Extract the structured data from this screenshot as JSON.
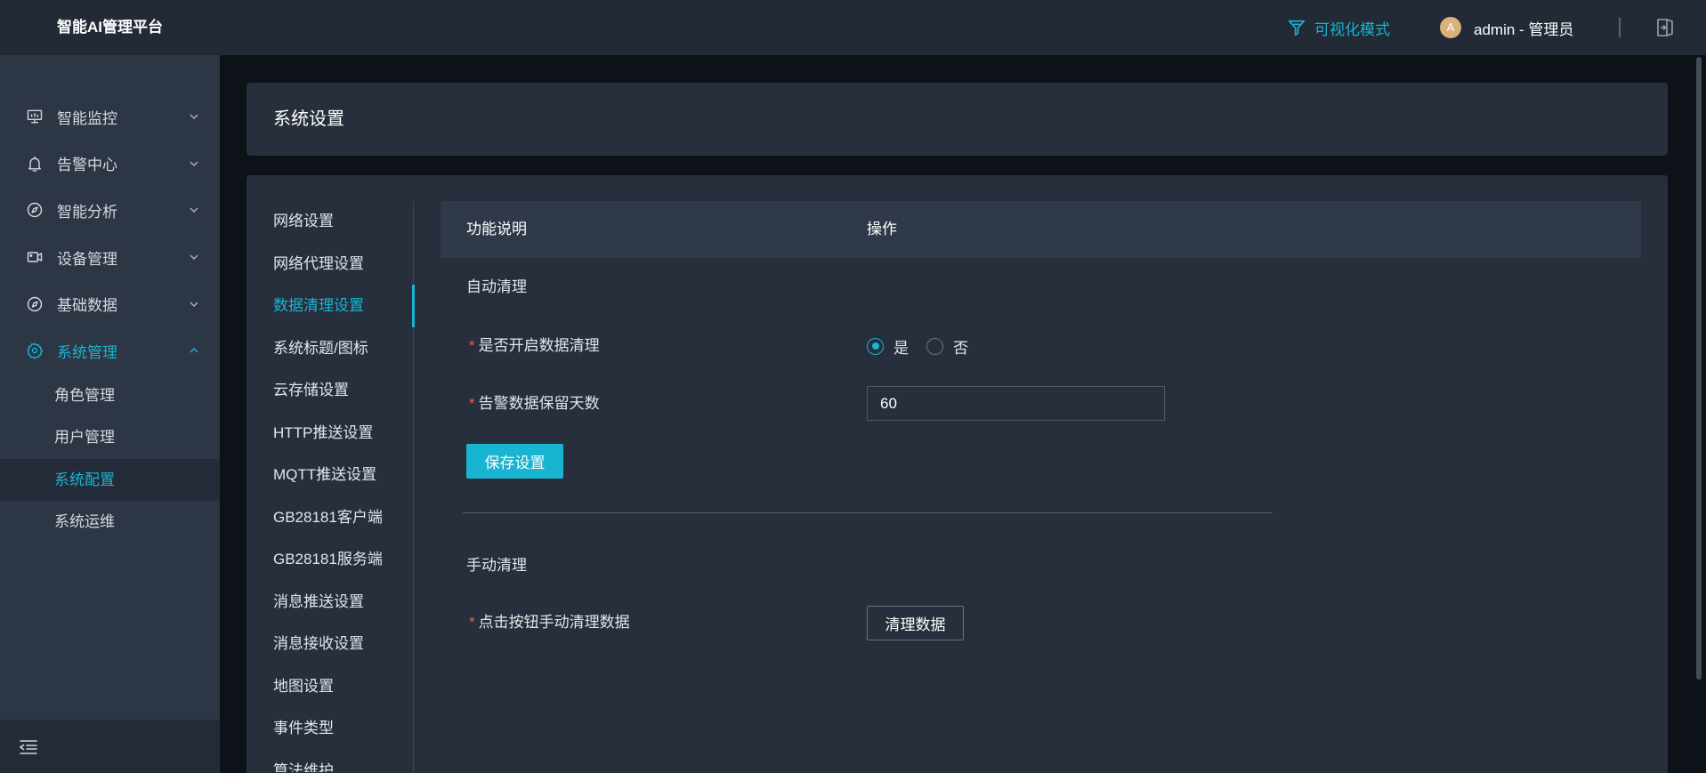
{
  "theme": {
    "accent": "#19b4d1",
    "required": "#f25a5a",
    "avatar": "#d8b27a"
  },
  "header": {
    "logo": "智能AI管理平台",
    "visual_mode": {
      "label": "可视化模式",
      "icon": "visual-mode-icon"
    },
    "user": {
      "avatar_initial": "A",
      "label": "admin - 管理员"
    },
    "logout_icon": "logout-icon"
  },
  "sidebar": {
    "menu": [
      {
        "label": "智能监控",
        "icon": "monitor-icon",
        "expanded": false
      },
      {
        "label": "告警中心",
        "icon": "bell-icon",
        "expanded": false
      },
      {
        "label": "智能分析",
        "icon": "compass-icon",
        "expanded": false
      },
      {
        "label": "设备管理",
        "icon": "video-camera-icon",
        "expanded": false
      },
      {
        "label": "基础数据",
        "icon": "discover-icon",
        "expanded": false
      },
      {
        "label": "系统管理",
        "icon": "gear-icon",
        "expanded": true,
        "children": [
          {
            "label": "角色管理"
          },
          {
            "label": "用户管理"
          },
          {
            "label": "系统配置",
            "active": true
          },
          {
            "label": "系统运维"
          }
        ]
      }
    ],
    "collapse_icon": "menu-fold-icon"
  },
  "page": {
    "title": "系统设置"
  },
  "settings_menu": {
    "active_index": 2,
    "items": [
      "网络设置",
      "网络代理设置",
      "数据清理设置",
      "系统标题/图标",
      "云存储设置",
      "HTTP推送设置",
      "MQTT推送设置",
      "GB28181客户端",
      "GB28181服务端",
      "消息推送设置",
      "消息接收设置",
      "地图设置",
      "事件类型",
      "算法维护"
    ]
  },
  "data_cleanup": {
    "columns": [
      "功能说明",
      "操作"
    ],
    "required_mark": "*",
    "auto_section": {
      "title": "自动清理",
      "enable_field": {
        "label": "是否开启数据清理",
        "options": [
          "是",
          "否"
        ],
        "selected_index": 0
      },
      "retention_field": {
        "label": "告警数据保留天数",
        "value": "60"
      },
      "save_button": "保存设置"
    },
    "manual_section": {
      "title": "手动清理",
      "clear_field": {
        "label": "点击按钮手动清理数据"
      },
      "clear_button": "清理数据"
    }
  }
}
